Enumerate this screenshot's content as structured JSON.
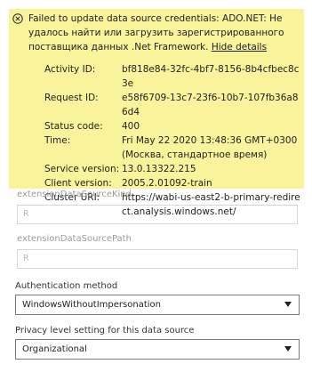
{
  "error_banner": {
    "message": "Failed to update data source credentials: ADO.NET: Не удалось найти или загрузить зарегистрированного поставщика данных .Net Framework.",
    "hide_link": "Hide details",
    "details": [
      {
        "label": "Activity ID:",
        "value": "bf818e84-32fc-4bf7-8156-8b4cfbec8c3e"
      },
      {
        "label": "Request ID:",
        "value": "e58f6709-13c7-23f6-10b7-107fb36a86d4"
      },
      {
        "label": "Status code:",
        "value": "400"
      },
      {
        "label": "Time:",
        "value": "Fri May 22 2020 13:48:36 GMT+0300 (Москва, стандартное время)"
      },
      {
        "label": "Service version:",
        "value": "13.0.13322.215"
      },
      {
        "label": "Client version:",
        "value": "2005.2.01092-train"
      },
      {
        "label": "Cluster URI:",
        "value": "https://wabi-us-east2-b-primary-redirect.analysis.windows.net/"
      }
    ]
  },
  "fields": {
    "kind": {
      "label": "extensionDataSourceKind",
      "value": "R"
    },
    "path": {
      "label": "extensionDataSourcePath",
      "value": "R"
    }
  },
  "auth": {
    "label": "Authentication method",
    "selected": "WindowsWithoutImpersonation"
  },
  "privacy": {
    "label": "Privacy level setting for this data source",
    "selected": "Organizational"
  },
  "colors": {
    "banner_bg": "#f9f39b",
    "text": "#222222",
    "muted": "#9a9a9a"
  },
  "icons": {
    "error": "close-circle-icon",
    "dropdown": "chevron-down-icon"
  }
}
